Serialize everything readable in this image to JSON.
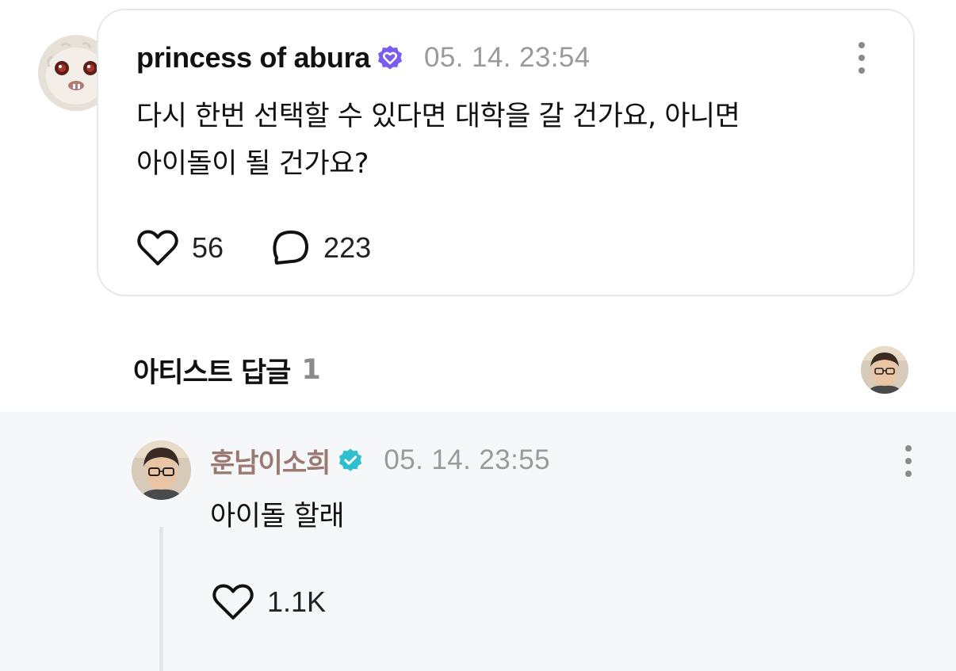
{
  "post": {
    "author": "princess of abura",
    "timestamp": "05. 14. 23:54",
    "body": "다시 한번 선택할 수 있다면 대학을 갈 건가요, 아니면\n아이돌이 될 건가요?",
    "like_count": "56",
    "reply_count": "223",
    "badge_color": "#7a5cf0"
  },
  "artist_replies": {
    "label": "아티스트 답글",
    "count": "1"
  },
  "reply": {
    "author": "훈남이소희",
    "timestamp": "05. 14. 23:55",
    "body": "아이돌 할래",
    "like_count": "1.1K",
    "badge_color": "#2fc0cf",
    "name_color": "#9b7a72"
  },
  "icons": {
    "post_like": "heart-outline-icon",
    "post_reply": "speech-bubble-icon",
    "post_more": "vertical-ellipsis-icon",
    "reply_like": "heart-outline-icon",
    "reply_more": "vertical-ellipsis-icon",
    "post_badge": "verified-heart-badge-icon",
    "reply_badge": "verified-check-badge-icon"
  }
}
